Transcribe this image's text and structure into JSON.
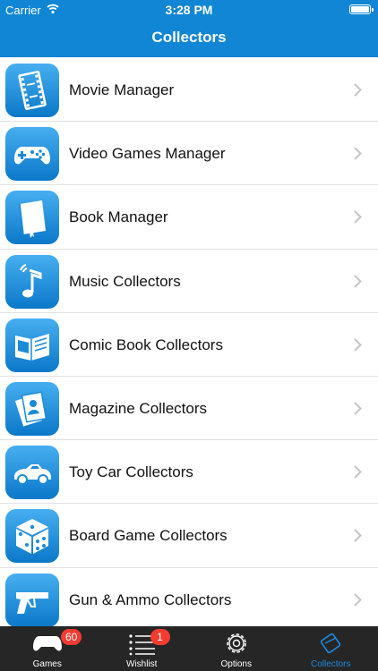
{
  "status_bar": {
    "carrier": "Carrier",
    "time": "3:28 PM"
  },
  "nav": {
    "title": "Collectors"
  },
  "list": {
    "items": [
      {
        "label": "Movie Manager",
        "icon": "film-strip-icon"
      },
      {
        "label": "Video Games Manager",
        "icon": "gamepad-icon"
      },
      {
        "label": "Book Manager",
        "icon": "book-icon"
      },
      {
        "label": "Music Collectors",
        "icon": "music-note-icon"
      },
      {
        "label": "Comic Book Collectors",
        "icon": "comic-book-icon"
      },
      {
        "label": "Magazine Collectors",
        "icon": "magazine-icon"
      },
      {
        "label": "Toy Car Collectors",
        "icon": "toy-car-icon"
      },
      {
        "label": "Board Game Collectors",
        "icon": "dice-icon"
      },
      {
        "label": "Gun & Ammo Collectors",
        "icon": "pistol-icon"
      }
    ]
  },
  "tabbar": {
    "tabs": [
      {
        "label": "Games",
        "badge": "60",
        "icon": "gamepad-icon"
      },
      {
        "label": "Wishlist",
        "badge": "1",
        "icon": "list-icon"
      },
      {
        "label": "Options",
        "badge": "",
        "icon": "gear-icon"
      },
      {
        "label": "Collectors",
        "badge": "",
        "icon": "collectors-icon",
        "active": true
      }
    ]
  },
  "colors": {
    "nav_blue": "#1186d4",
    "tab_active": "#1c8be0",
    "badge_red": "#f23c32",
    "tabbar_bg": "#262626"
  }
}
